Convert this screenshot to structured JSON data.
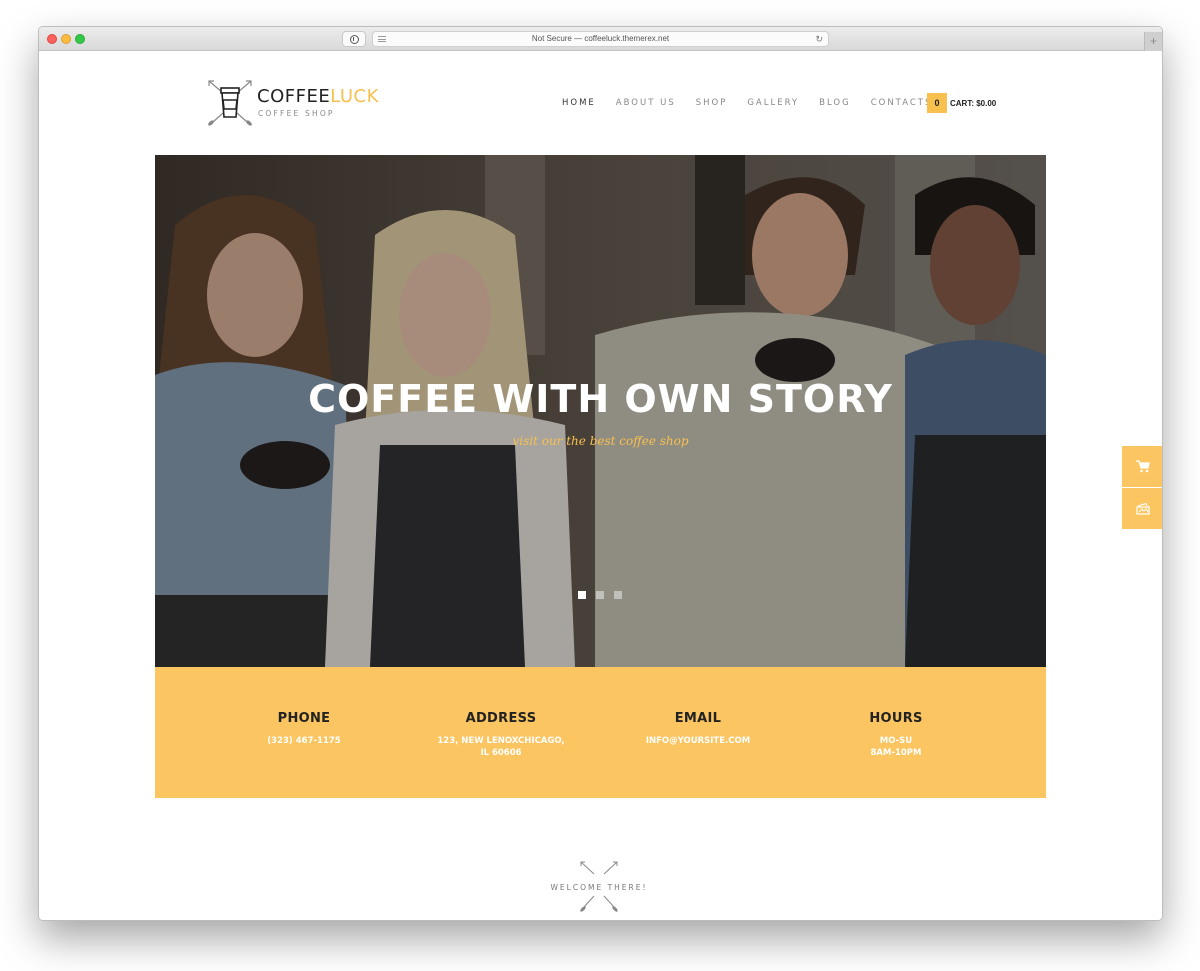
{
  "browser": {
    "url_text": "Not Secure — coffeeluck.themerex.net",
    "new_tab_label": "+"
  },
  "header": {
    "logo": {
      "name_main": "COFFEE",
      "name_accent": "LUCK",
      "subtitle": "COFFEE SHOP"
    },
    "nav": [
      {
        "label": "HOME",
        "active": true
      },
      {
        "label": "ABOUT US",
        "active": false
      },
      {
        "label": "SHOP",
        "active": false
      },
      {
        "label": "GALLERY",
        "active": false
      },
      {
        "label": "BLOG",
        "active": false
      },
      {
        "label": "CONTACTS",
        "active": false
      }
    ],
    "cart": {
      "count": "0",
      "label": "CART: $0.00"
    }
  },
  "hero": {
    "title": "COFFEE WITH OWN STORY",
    "subtitle": "visit our the best coffee shop",
    "slides_total": 3,
    "active_slide": 1
  },
  "info": [
    {
      "title": "PHONE",
      "lines": [
        "(323) 467-1175"
      ]
    },
    {
      "title": "ADDRESS",
      "lines": [
        "123, NEW LENOXCHICAGO,",
        "IL 60606"
      ]
    },
    {
      "title": "EMAIL",
      "lines": [
        "INFO@YOURSITE.COM"
      ]
    },
    {
      "title": "HOURS",
      "lines": [
        "MO-SU",
        "8AM-10PM"
      ]
    }
  ],
  "side_widgets": [
    {
      "icon": "cart-icon"
    },
    {
      "icon": "gallery-icon"
    }
  ],
  "welcome": {
    "text": "WELCOME THERE!"
  },
  "colors": {
    "accent": "#fbc561",
    "logo_accent": "#f8c04f",
    "text_dark": "#222222",
    "nav_inactive": "#888888"
  }
}
